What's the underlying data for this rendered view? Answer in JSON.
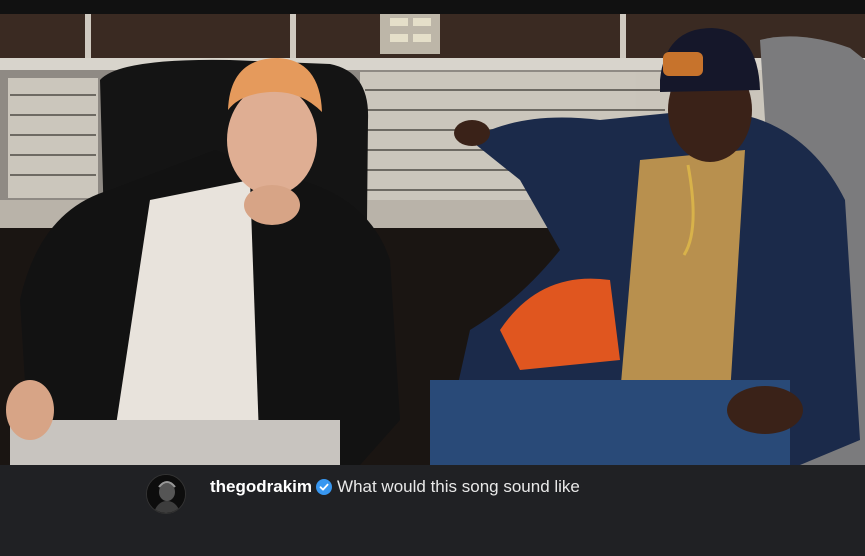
{
  "post": {
    "image_icon": "photo-studio-two-men",
    "author": {
      "username": "thegodrakim",
      "verified": true,
      "avatar_icon": "profile-avatar"
    },
    "caption": "What would this song sound like"
  },
  "colors": {
    "caption_background": "#202124",
    "username": "#ffffff",
    "caption_text": "#e8e8e8",
    "verified_badge": "#3897f0"
  }
}
